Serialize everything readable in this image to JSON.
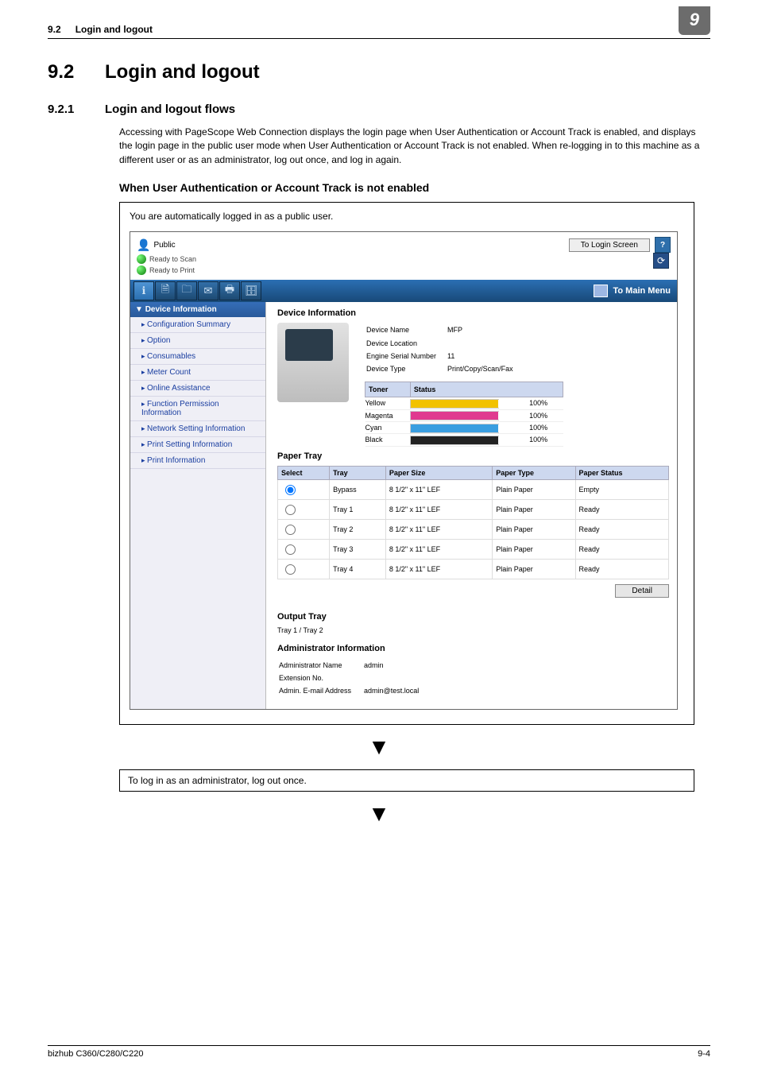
{
  "page_header": {
    "section_number": "9.2",
    "section_title": "Login and logout",
    "chapter_badge": "9"
  },
  "h1": {
    "num": "9.2",
    "title": "Login and logout"
  },
  "h2": {
    "num": "9.2.1",
    "title": "Login and logout flows"
  },
  "paragraph": "Accessing with PageScope Web Connection displays the login page when User Authentication or Account Track is enabled, and displays the login page in the public user mode when User Authentication or Account Track is not enabled. When re-logging in to this machine as a different user or as an administrator, log out once, and log in again.",
  "h3": "When User Authentication or Account Track is not enabled",
  "box_note": "You are automatically logged in as a public user.",
  "app": {
    "user_mode": "Public",
    "login_button": "To Login Screen",
    "help": "?",
    "status_scan": "Ready to Scan",
    "status_print": "Ready to Print",
    "to_main_menu": "To Main Menu",
    "side_header": "Device Information",
    "side_items": [
      "Configuration Summary",
      "Option",
      "Consumables",
      "Meter Count",
      "Online Assistance",
      "Function Permission Information",
      "Network Setting Information",
      "Print Setting Information",
      "Print Information"
    ],
    "main_heading": "Device Information",
    "device": {
      "name_label": "Device Name",
      "name": "MFP",
      "location_label": "Device Location",
      "location": "",
      "serial_label": "Engine Serial Number",
      "serial": "11",
      "type_label": "Device Type",
      "type": "Print/Copy/Scan/Fax"
    },
    "toner_headers": {
      "toner": "Toner",
      "status": "Status"
    },
    "toners": [
      {
        "name": "Yellow",
        "cls": "y",
        "pct": "100%"
      },
      {
        "name": "Magenta",
        "cls": "m",
        "pct": "100%"
      },
      {
        "name": "Cyan",
        "cls": "c",
        "pct": "100%"
      },
      {
        "name": "Black",
        "cls": "k",
        "pct": "100%"
      }
    ],
    "paper_title": "Paper Tray",
    "paper_headers": {
      "select": "Select",
      "tray": "Tray",
      "size": "Paper Size",
      "type": "Paper Type",
      "status": "Paper Status"
    },
    "paper_rows": [
      {
        "tray": "Bypass",
        "size": "8 1/2\" x 11\" LEF",
        "type": "Plain Paper",
        "status": "Empty",
        "selected": true
      },
      {
        "tray": "Tray 1",
        "size": "8 1/2\" x 11\" LEF",
        "type": "Plain Paper",
        "status": "Ready",
        "selected": false
      },
      {
        "tray": "Tray 2",
        "size": "8 1/2\" x 11\" LEF",
        "type": "Plain Paper",
        "status": "Ready",
        "selected": false
      },
      {
        "tray": "Tray 3",
        "size": "8 1/2\" x 11\" LEF",
        "type": "Plain Paper",
        "status": "Ready",
        "selected": false
      },
      {
        "tray": "Tray 4",
        "size": "8 1/2\" x 11\" LEF",
        "type": "Plain Paper",
        "status": "Ready",
        "selected": false
      }
    ],
    "detail_button": "Detail",
    "output_title": "Output Tray",
    "output_value": "Tray 1 / Tray 2",
    "admin_title": "Administrator Information",
    "admin": {
      "name_label": "Administrator Name",
      "name": "admin",
      "ext_label": "Extension No.",
      "ext": "",
      "email_label": "Admin. E-mail Address",
      "email": "admin@test.local"
    }
  },
  "note_box": "To log in as an administrator, log out once.",
  "footer": {
    "model": "bizhub C360/C280/C220",
    "page": "9-4"
  }
}
